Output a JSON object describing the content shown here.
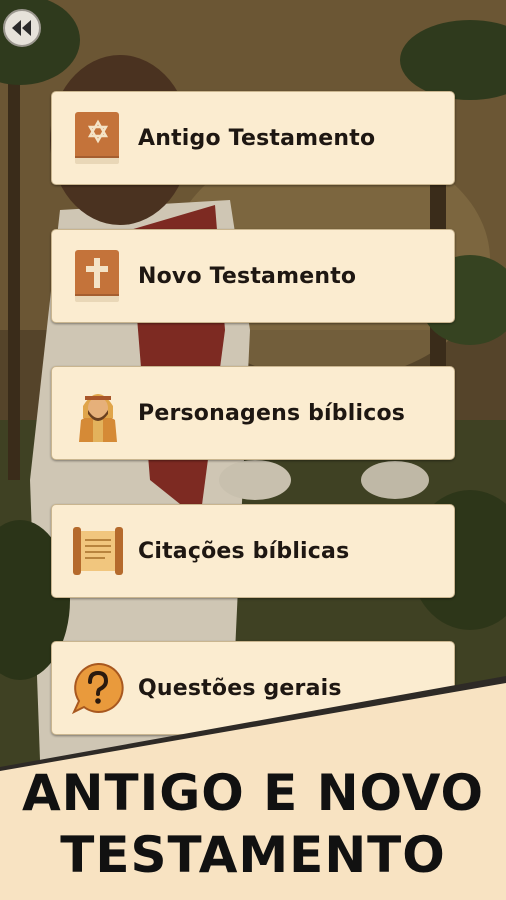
{
  "back_button": {
    "icon": "rewind-icon"
  },
  "menu": [
    {
      "label": "Antigo Testamento",
      "icon": "star-of-david-book-icon"
    },
    {
      "label": "Novo Testamento",
      "icon": "cross-book-icon"
    },
    {
      "label": "Personagens bíblicos",
      "icon": "biblical-character-icon"
    },
    {
      "label": "Citações bíblicas",
      "icon": "scroll-icon"
    },
    {
      "label": "Questões gerais",
      "icon": "question-bubble-icon"
    }
  ],
  "banner": {
    "line1": "ANTIGO E NOVO",
    "line2": "TESTAMENTO"
  },
  "colors": {
    "card": "#fbecd0",
    "banner": "#f8e3c2",
    "book": "#c4733a",
    "text": "#1e1712"
  }
}
